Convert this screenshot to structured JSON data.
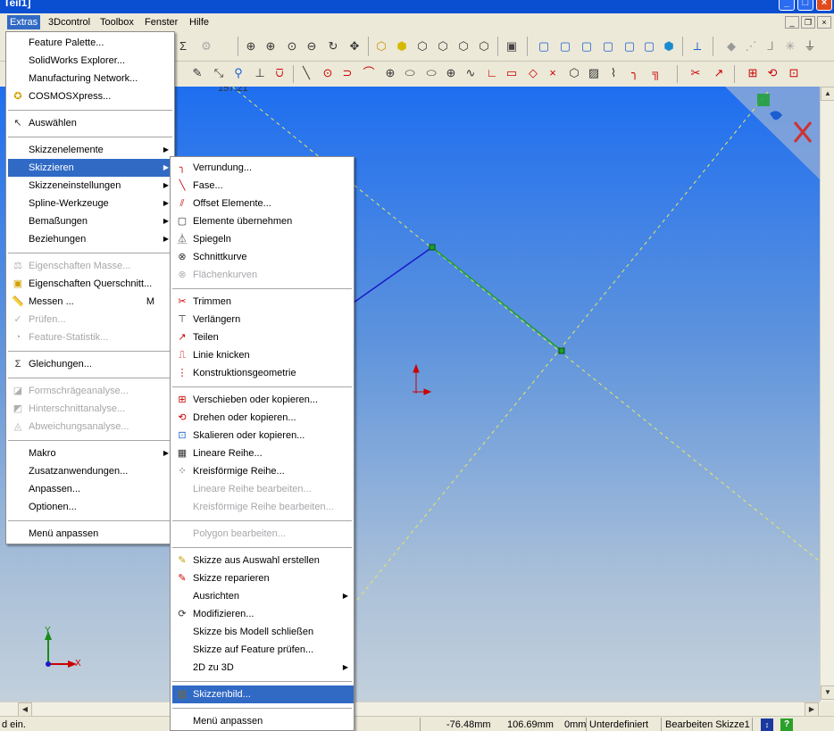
{
  "window": {
    "title": "Teil1]"
  },
  "menubar": {
    "items": [
      "Extras",
      "3Dcontrol",
      "Toolbox",
      "Fenster",
      "Hilfe"
    ]
  },
  "viewport": {
    "dim_label": "157.21",
    "axis_x": "X",
    "axis_y": "Y"
  },
  "extras_menu": {
    "items": [
      {
        "label": "Feature Palette...",
        "icon": "none",
        "enabled": true
      },
      {
        "label": "SolidWorks Explorer...",
        "icon": "none",
        "enabled": true
      },
      {
        "label": "Manufacturing Network...",
        "icon": "none",
        "enabled": true
      },
      {
        "label": "COSMOSXpress...",
        "icon": "cosmos-icon",
        "enabled": true
      },
      {
        "label": "Auswählen",
        "icon": "cursor-icon",
        "enabled": true
      },
      {
        "label": "Skizzenelemente",
        "submenu": true,
        "enabled": true
      },
      {
        "label": "Skizzieren",
        "submenu": true,
        "enabled": true,
        "highlighted": true
      },
      {
        "label": "Skizzeneinstellungen",
        "submenu": true,
        "enabled": true
      },
      {
        "label": "Spline-Werkzeuge",
        "submenu": true,
        "enabled": true
      },
      {
        "label": "Bemaßungen",
        "submenu": true,
        "enabled": true
      },
      {
        "label": "Beziehungen",
        "submenu": true,
        "enabled": true
      },
      {
        "label": "Eigenschaften Masse...",
        "icon": "mass-icon",
        "enabled": false
      },
      {
        "label": "Eigenschaften Querschnitt...",
        "icon": "section-icon",
        "enabled": true
      },
      {
        "label": "Messen ...",
        "shortcut": "M",
        "icon": "measure-icon",
        "enabled": true
      },
      {
        "label": "Prüfen...",
        "icon": "check-icon",
        "enabled": false
      },
      {
        "label": "Feature-Statistik...",
        "icon": "stats-icon",
        "enabled": false
      },
      {
        "label": "Gleichungen...",
        "icon": "sigma-icon",
        "enabled": true
      },
      {
        "label": "Formschrägeanalyse...",
        "icon": "draft-icon",
        "enabled": false
      },
      {
        "label": "Hinterschnittanalyse...",
        "icon": "undercut-icon",
        "enabled": false
      },
      {
        "label": "Abweichungsanalyse...",
        "icon": "deviation-icon",
        "enabled": false
      },
      {
        "label": "Makro",
        "submenu": true,
        "enabled": true
      },
      {
        "label": "Zusatzanwendungen...",
        "enabled": true
      },
      {
        "label": "Anpassen...",
        "enabled": true
      },
      {
        "label": "Optionen...",
        "enabled": true
      },
      {
        "label": "Menü anpassen",
        "enabled": true
      }
    ]
  },
  "skizzieren_menu": {
    "items": [
      {
        "label": "Verrundung...",
        "icon": "fillet-icon",
        "enabled": true
      },
      {
        "label": "Fase...",
        "icon": "chamfer-icon",
        "enabled": true
      },
      {
        "label": "Offset Elemente...",
        "icon": "offset-icon",
        "enabled": true
      },
      {
        "label": "Elemente übernehmen",
        "icon": "convert-icon",
        "enabled": true
      },
      {
        "label": "Spiegeln",
        "icon": "mirror-icon",
        "enabled": true
      },
      {
        "label": "Schnittkurve",
        "icon": "intersection-icon",
        "enabled": true
      },
      {
        "label": "Flächenkurven",
        "icon": "face-curves-icon",
        "enabled": false
      },
      {
        "label": "Trimmen",
        "icon": "trim-icon",
        "enabled": true
      },
      {
        "label": "Verlängern",
        "icon": "extend-icon",
        "enabled": true
      },
      {
        "label": "Teilen",
        "icon": "split-icon",
        "enabled": true
      },
      {
        "label": "Linie knicken",
        "icon": "jog-icon",
        "enabled": true
      },
      {
        "label": "Konstruktionsgeometrie",
        "icon": "construction-icon",
        "enabled": true
      },
      {
        "label": "Verschieben oder kopieren...",
        "icon": "move-icon",
        "enabled": true
      },
      {
        "label": "Drehen oder kopieren...",
        "icon": "rotate-icon",
        "enabled": true
      },
      {
        "label": "Skalieren oder kopieren...",
        "icon": "scale-icon",
        "enabled": true
      },
      {
        "label": "Lineare Reihe...",
        "icon": "linear-pattern-icon",
        "enabled": true
      },
      {
        "label": "Kreisförmige Reihe...",
        "icon": "circular-pattern-icon",
        "enabled": true
      },
      {
        "label": "Lineare Reihe bearbeiten...",
        "enabled": false
      },
      {
        "label": "Kreisförmige Reihe bearbeiten...",
        "enabled": false
      },
      {
        "label": "Polygon bearbeiten...",
        "enabled": false
      },
      {
        "label": "Skizze aus Auswahl erstellen",
        "icon": "sketch-from-selection-icon",
        "enabled": true
      },
      {
        "label": "Skizze reparieren",
        "icon": "repair-icon",
        "enabled": true
      },
      {
        "label": "Ausrichten",
        "submenu": true,
        "enabled": true
      },
      {
        "label": "Modifizieren...",
        "icon": "modify-icon",
        "enabled": true
      },
      {
        "label": "Skizze bis Modell schließen",
        "enabled": true
      },
      {
        "label": "Skizze auf Feature prüfen...",
        "enabled": true
      },
      {
        "label": "2D zu 3D",
        "submenu": true,
        "enabled": true
      },
      {
        "label": "Skizzenbild...",
        "icon": "sketch-picture-icon",
        "enabled": true,
        "highlighted": true
      },
      {
        "label": "Menü anpassen",
        "enabled": true
      }
    ]
  },
  "statusbar": {
    "left": "d ein.",
    "x": "-76.48mm",
    "y": "106.69mm",
    "z": "0mm",
    "state": "Unterdefiniert",
    "edit": "Bearbeiten Skizze1"
  },
  "colors": {
    "highlight": "#316ac5",
    "titlebar": "#0a4ed2",
    "sketch_blue": "#1a1acc",
    "sketch_green": "#1aa02c",
    "construction": "#e8e860"
  }
}
